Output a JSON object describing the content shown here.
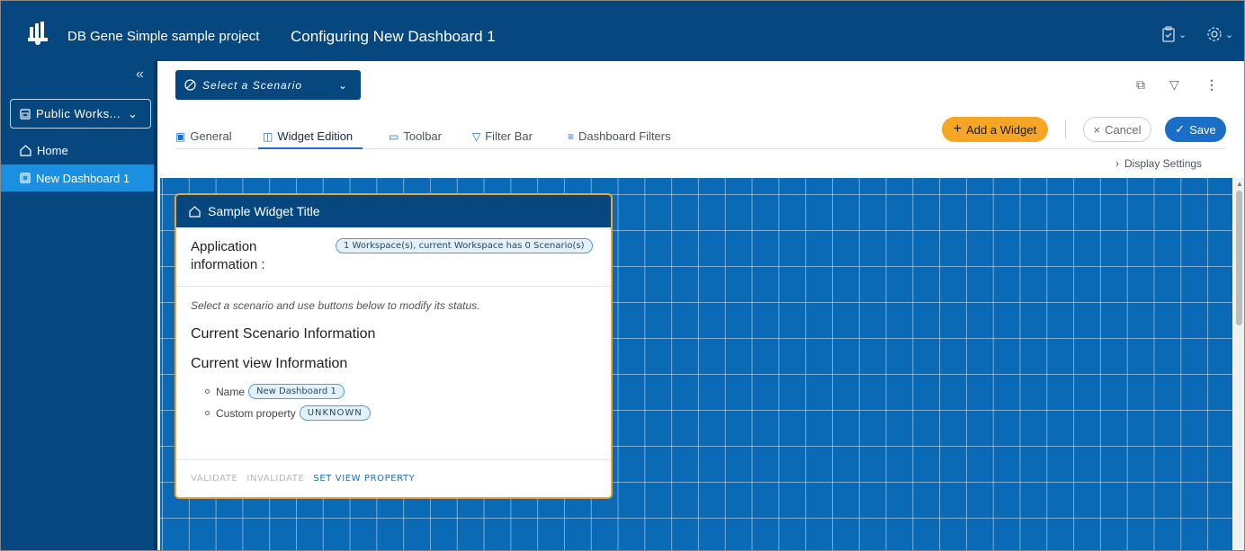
{
  "header": {
    "project_name": "DB Gene Simple sample project",
    "page_title": "Configuring New Dashboard 1",
    "icons": [
      "clipboard-check-icon",
      "gear-icon"
    ]
  },
  "sidebar": {
    "collapse_icon": "double-chevron-left-icon",
    "workspace_select": "Public Works...",
    "items": [
      {
        "label": "Home",
        "icon": "home-icon",
        "active": false
      },
      {
        "label": "New Dashboard 1",
        "icon": "dashboard-icon",
        "active": true
      }
    ]
  },
  "toolbar": {
    "scenario_placeholder": "Select a Scenario",
    "tabs": [
      {
        "label": "General",
        "active": false
      },
      {
        "label": "Widget Edition",
        "active": true
      },
      {
        "label": "Toolbar",
        "active": false
      },
      {
        "label": "Filter Bar",
        "active": false
      },
      {
        "label": "Dashboard Filters",
        "active": false
      }
    ],
    "add_widget": "Add a Widget",
    "cancel": "Cancel",
    "save": "Save",
    "display_settings": "Display Settings"
  },
  "widget": {
    "title": "Sample Widget Title",
    "app_info_label": "Application information :",
    "workspace_info": "1 Workspace(s), current Workspace has 0 Scenario(s)",
    "hint": "Select a scenario and use buttons below to modify its status.",
    "current_scenario_heading": "Current Scenario Information",
    "current_view_heading": "Current view Information",
    "name_label": "Name",
    "name_value": "New Dashboard 1",
    "custom_property_label": "Custom property",
    "custom_property_value": "UNKNOWN",
    "actions": {
      "validate": "VALIDATE",
      "invalidate": "INVALIDATE",
      "set_view_property": "SET VIEW PROPERTY"
    }
  },
  "colors": {
    "brand": "#06477f",
    "accent": "#1a6ec8",
    "add_widget": "#f6a623",
    "active_nav": "#1b8fe0"
  }
}
